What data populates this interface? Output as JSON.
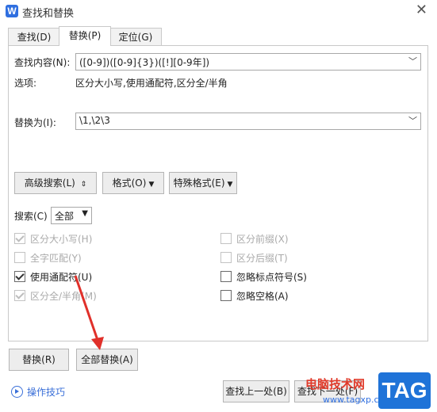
{
  "window": {
    "title": "查找和替换",
    "app_icon_letter": "W",
    "close_glyph": "✕"
  },
  "tabs": [
    {
      "label": "查找(D)",
      "active": false
    },
    {
      "label": "替换(P)",
      "active": true
    },
    {
      "label": "定位(G)",
      "active": false
    }
  ],
  "find": {
    "label": "查找内容(N):",
    "value": "([0-9])([0-9]{3})([!][0-9年])"
  },
  "options": {
    "label": "选项:",
    "value": "区分大小写,使用通配符,区分全/半角"
  },
  "replace": {
    "label": "替换为(I):",
    "value": "\\1,\\2\\3"
  },
  "buttons": {
    "advanced": "高级搜索(L)",
    "advanced_glyph": "⇕",
    "format": "格式(O)",
    "special": "特殊格式(E)",
    "replace": "替换(R)",
    "replace_all": "全部替换(A)",
    "find_prev": "查找上一处(B)",
    "find_next": "查找下一处(F)"
  },
  "search": {
    "label": "搜索(C)",
    "value": "全部"
  },
  "checkboxes_left": [
    {
      "label": "区分大小写(H)",
      "checked": true,
      "disabled": true
    },
    {
      "label": "全字匹配(Y)",
      "checked": false,
      "disabled": true
    },
    {
      "label": "使用通配符(U)",
      "checked": true,
      "disabled": false
    },
    {
      "label": "区分全/半角(M)",
      "checked": true,
      "disabled": true
    }
  ],
  "checkboxes_right": [
    {
      "label": "区分前缀(X)",
      "checked": false,
      "disabled": true
    },
    {
      "label": "区分后缀(T)",
      "checked": false,
      "disabled": true
    },
    {
      "label": "忽略标点符号(S)",
      "checked": false,
      "disabled": false
    },
    {
      "label": "忽略空格(A)",
      "checked": false,
      "disabled": false
    }
  ],
  "tips": "操作技巧",
  "watermark": {
    "text": "电脑技术网",
    "url": "www.tagxp.com",
    "tag": "TAG"
  },
  "colors": {
    "arrow": "#e0302a",
    "link": "#3a6fd8",
    "brand": "#1f73d8"
  }
}
